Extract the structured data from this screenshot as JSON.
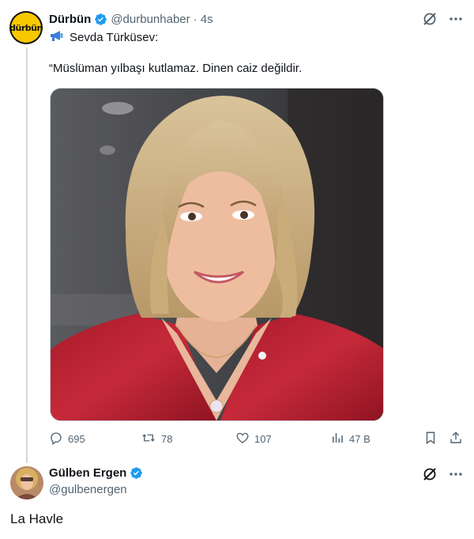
{
  "tweet": {
    "author_name": "Dürbün",
    "author_handle": "@durbunhaber",
    "time": "· 4s",
    "avatar_logo_text": "dürbün",
    "subline_icon": "megaphone-icon",
    "subline_text": "Sevda Türküsev:",
    "body": "“Müslüman yılbaşı kutlamaz. Dinen caiz değildir.",
    "stats": {
      "replies": "695",
      "retweets": "78",
      "likes": "107",
      "views": "47 B"
    }
  },
  "reply": {
    "author_name": "Gülben Ergen",
    "author_handle": "@gulbenergen",
    "body": "La Havle"
  },
  "colors": {
    "verified": "#1d9bf0",
    "muted": "#536471",
    "thread_line": "#cfd9de",
    "avatar_yellow": "#f7c800"
  }
}
